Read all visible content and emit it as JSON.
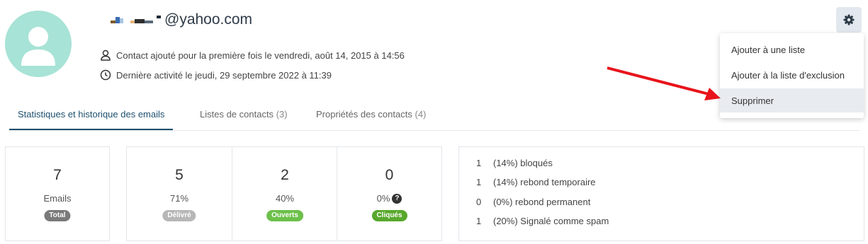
{
  "contact": {
    "email_suffix": "@yahoo.com",
    "added_line": "Contact ajouté pour la première fois le vendredi, août 14, 2015 à 14:56",
    "activity_line": "Dernière activité le jeudi, 29 septembre 2022 à 11:39"
  },
  "icons": {
    "avatar": "user-silhouette-icon",
    "added": "user-outline-icon",
    "activity": "clock-icon",
    "settings": "gear-icon",
    "help": "question-circle-icon"
  },
  "menu": {
    "items": [
      "Ajouter à une liste",
      "Ajouter à la liste d'exclusion",
      "Supprimer"
    ]
  },
  "tabs": [
    {
      "label": "Statistiques et historique des emails",
      "count": ""
    },
    {
      "label": "Listes de contacts",
      "count": "(3)"
    },
    {
      "label": "Propriétés des contacts",
      "count": "(4)"
    }
  ],
  "stats": {
    "total": {
      "value": "7",
      "sub": "Emails",
      "badge": "Total"
    },
    "delivered": {
      "value": "5",
      "sub": "71%",
      "badge": "Délivré"
    },
    "opened": {
      "value": "2",
      "sub": "40%",
      "badge": "Ouverts"
    },
    "clicked": {
      "value": "0",
      "sub": "0%",
      "badge": "Cliqués"
    }
  },
  "details": [
    {
      "count": "1",
      "text": "(14%) bloqués"
    },
    {
      "count": "1",
      "text": "(14%) rebond temporaire"
    },
    {
      "count": "0",
      "text": "(0%) rebond permanent"
    },
    {
      "count": "1",
      "text": "(20%) Signalé comme spam"
    }
  ],
  "colors": {
    "avatar_bg": "#a7e3d6",
    "badge_total": "#7a7a7a",
    "badge_delivered": "#b7b7b7",
    "badge_opened": "#6cc04a",
    "badge_clicked": "#58a82c",
    "annotation_arrow": "#e8141b",
    "tab_active": "#1d4f6e"
  }
}
